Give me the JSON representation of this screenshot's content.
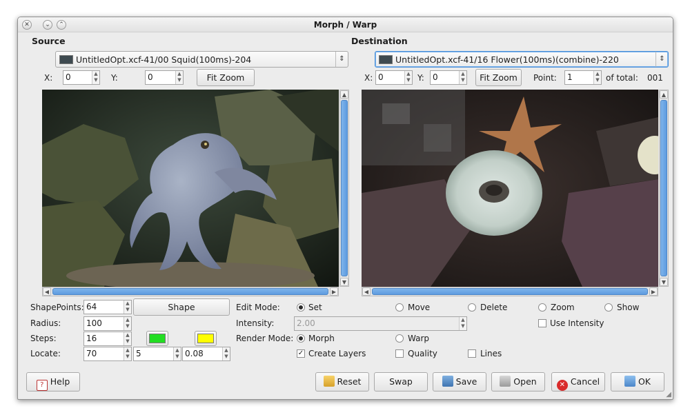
{
  "window": {
    "title": "Morph / Warp"
  },
  "source": {
    "heading": "Source",
    "layer": "UntitledOpt.xcf-41/00 Squid(100ms)-204",
    "x_label": "X:",
    "x_value": "0",
    "y_label": "Y:",
    "y_value": "0",
    "fit_zoom": "Fit Zoom"
  },
  "destination": {
    "heading": "Destination",
    "layer": "UntitledOpt.xcf-41/16 Flower(100ms)(combine)-220",
    "x_label": "X:",
    "x_value": "0",
    "y_label": "Y:",
    "y_value": "0",
    "fit_zoom": "Fit Zoom",
    "point_label": "Point:",
    "point_value": "1",
    "total_label": "of total:",
    "total_value": "001"
  },
  "scrollbar": {
    "grip": "III",
    "vgrip": "≡"
  },
  "params": {
    "shapepoints_label": "ShapePoints:",
    "shapepoints_value": "64",
    "shape_button": "Shape",
    "radius_label": "Radius:",
    "radius_value": "100",
    "steps_label": "Steps:",
    "steps_value": "16",
    "locate_label": "Locate:",
    "locate_value1": "70",
    "locate_value2": "5",
    "locate_value3": "0.08",
    "swatch1_color": "#22dd22",
    "swatch2_color": "#ffff00"
  },
  "edit_mode": {
    "label": "Edit Mode:",
    "options": [
      "Set",
      "Move",
      "Delete",
      "Zoom",
      "Show"
    ],
    "selected": "Set"
  },
  "intensity": {
    "label": "Intensity:",
    "value": "2.00",
    "use_intensity": "Use Intensity"
  },
  "render_mode": {
    "label": "Render Mode:",
    "options": [
      "Morph",
      "Warp"
    ],
    "selected": "Morph"
  },
  "options": {
    "create_layers": "Create Layers",
    "quality": "Quality",
    "lines": "Lines"
  },
  "buttons": {
    "help": "Help",
    "reset": "Reset",
    "swap": "Swap",
    "save": "Save",
    "open": "Open",
    "cancel": "Cancel",
    "ok": "OK"
  },
  "colors": {
    "accent": "#5d9be0",
    "window_bg": "#ececec"
  }
}
